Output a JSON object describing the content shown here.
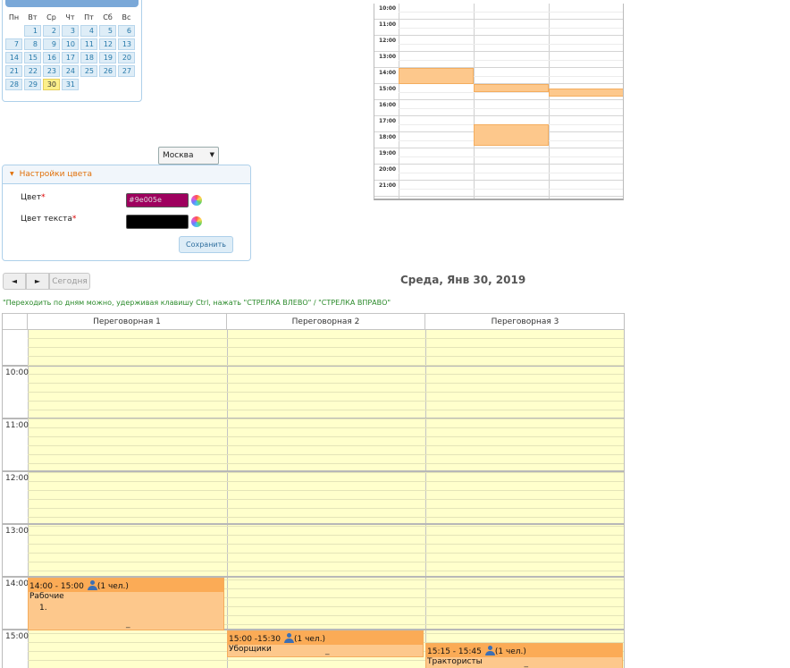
{
  "mini_calendar": {
    "weekdays": [
      "Пн",
      "Вт",
      "Ср",
      "Чт",
      "Пт",
      "Сб",
      "Вс"
    ],
    "weeks": [
      [
        "",
        "1",
        "2",
        "3",
        "4",
        "5",
        "6"
      ],
      [
        "7",
        "8",
        "9",
        "10",
        "11",
        "12",
        "13"
      ],
      [
        "14",
        "15",
        "16",
        "17",
        "18",
        "19",
        "20"
      ],
      [
        "21",
        "22",
        "23",
        "24",
        "25",
        "26",
        "27"
      ],
      [
        "28",
        "29",
        "30",
        "31",
        "",
        "",
        ""
      ]
    ],
    "today": "30"
  },
  "overview": {
    "hours": [
      "10:00",
      "11:00",
      "12:00",
      "13:00",
      "14:00",
      "15:00",
      "16:00",
      "17:00",
      "18:00",
      "19:00",
      "20:00",
      "21:00"
    ]
  },
  "city_select": {
    "value": "Москва"
  },
  "color_panel": {
    "title": "Настройки цвета",
    "color_label": "Цвет",
    "color_value": "#9e005e",
    "text_color_label": "Цвет текста",
    "text_color_value": "#000000",
    "required_mark": "*",
    "save_label": "Сохранить"
  },
  "nav": {
    "prev": "◄",
    "next": "►",
    "today": "Сегодня"
  },
  "day_title": "Среда, Янв 30, 2019",
  "hint": "\"Переходить по дням можно, удерживая клавишу Ctrl, нажать \"СТРЕЛКА ВЛЕВО\" / \"СТРЕЛКА ВПРАВО\"",
  "resources": [
    "Переговорная 1",
    "Переговорная 2",
    "Переговорная 3"
  ],
  "time_labels": [
    "10:00",
    "11:00",
    "12:00",
    "13:00",
    "14:00",
    "15:00"
  ],
  "events": [
    {
      "time": "14:00 - 15:00",
      "people": "(1 чел.)",
      "title": "Рабочие",
      "item": "1.",
      "handle": "_"
    },
    {
      "time": "15:00 -15:30",
      "people": "(1 чел.)",
      "title": "Уборщики",
      "handle": "_"
    },
    {
      "time": "15:15 - 15:45",
      "people": "(1 чел.)",
      "title": "Трактористы",
      "handle": "_"
    }
  ],
  "colors": {
    "event_fill": "#fdc88c",
    "event_header": "#fbab56",
    "slot_bg": "#ffffcc",
    "today_highlight": "#fcef8a",
    "accent_orange": "#e17009"
  }
}
